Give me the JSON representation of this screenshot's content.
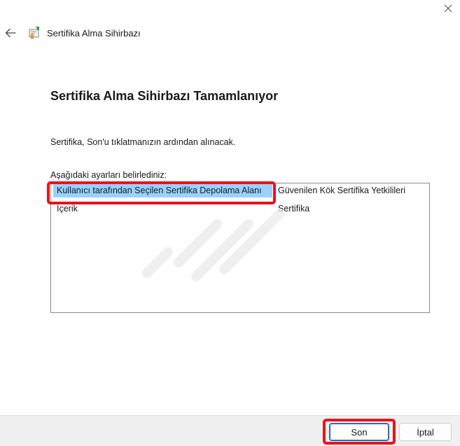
{
  "window": {
    "close_icon": "close-icon",
    "back_icon": "back-arrow-icon",
    "app_icon": "certificate-wizard-icon",
    "title": "Sertifika Alma Sihirbazı"
  },
  "main": {
    "heading": "Sertifika Alma Sihirbazı Tamamlanıyor",
    "info": "Sertifika, Son'u tıklatmanızın ardından alınacak.",
    "settings_label": "Aşağıdaki ayarları belirlediniz:",
    "settings": [
      {
        "name": "Kullanıcı tarafından Seçilen Sertifika Depolama Alanı",
        "value": "Güvenilen Kök Sertifika Yetkilileri",
        "selected": true
      },
      {
        "name": "İçerik",
        "value": "Sertifika",
        "selected": false
      }
    ]
  },
  "footer": {
    "finish_label": "Son",
    "cancel_label": "İptal"
  },
  "colors": {
    "selection": "#99d1ff",
    "highlight": "#e8141b",
    "primary_border": "#2b6cc4"
  }
}
